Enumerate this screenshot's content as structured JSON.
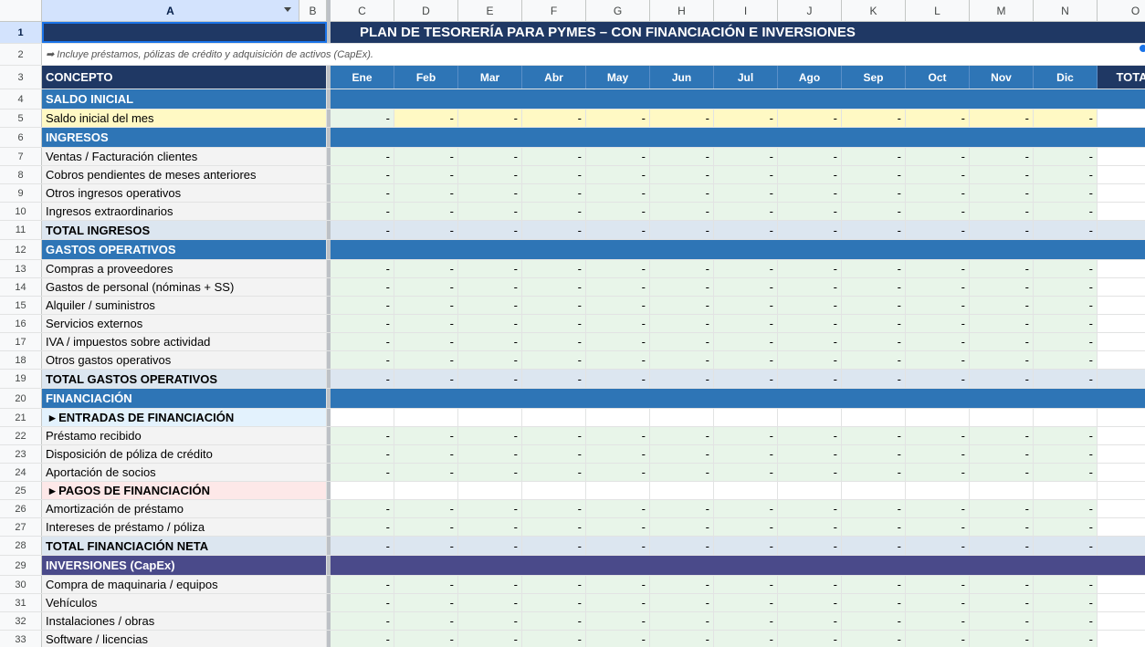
{
  "sheet": {
    "columns": [
      "A",
      "B",
      "C",
      "D",
      "E",
      "F",
      "G",
      "H",
      "I",
      "J",
      "K",
      "L",
      "M",
      "N",
      "O"
    ],
    "selected_column": "A",
    "title": "PLAN DE TESORERÍA PARA PYMES – CON FINANCIACIÓN E INVERSIONES",
    "note": "➡ Incluye préstamos, pólizas de crédito y adquisición de activos (CapEx).",
    "concept_header": "CONCEPTO",
    "months": [
      "Ene",
      "Feb",
      "Mar",
      "Abr",
      "May",
      "Jun",
      "Jul",
      "Ago",
      "Sep",
      "Oct",
      "Nov",
      "Dic"
    ],
    "total_header": "TOTAL",
    "empty_value": "-",
    "colors": {
      "title_bg": "#1f3864",
      "section_bg": "#2e75b6",
      "capex_bg": "#4a4a8a",
      "total_row_bg": "#dce6f0",
      "input_green": "#e8f5e9",
      "input_yellow": "#fff9c4",
      "entradas_bg": "#e3f2fd",
      "pagos_bg": "#fde8e8",
      "label_bg": "#f3f3f3"
    },
    "rows": [
      {
        "n": "4",
        "label": "SALDO INICIAL",
        "type": "section"
      },
      {
        "n": "5",
        "label": "Saldo inicial del mes",
        "type": "saldo"
      },
      {
        "n": "6",
        "label": "INGRESOS",
        "type": "section"
      },
      {
        "n": "7",
        "label": "Ventas / Facturación clientes",
        "type": "data"
      },
      {
        "n": "8",
        "label": "Cobros pendientes de meses anteriores",
        "type": "data"
      },
      {
        "n": "9",
        "label": "Otros ingresos operativos",
        "type": "data"
      },
      {
        "n": "10",
        "label": "Ingresos extraordinarios",
        "type": "data"
      },
      {
        "n": "11",
        "label": "TOTAL INGRESOS",
        "type": "total"
      },
      {
        "n": "12",
        "label": "GASTOS OPERATIVOS",
        "type": "section"
      },
      {
        "n": "13",
        "label": "Compras a proveedores",
        "type": "data"
      },
      {
        "n": "14",
        "label": "Gastos de personal (nóminas + SS)",
        "type": "data"
      },
      {
        "n": "15",
        "label": "Alquiler / suministros",
        "type": "data"
      },
      {
        "n": "16",
        "label": "Servicios externos",
        "type": "data"
      },
      {
        "n": "17",
        "label": "IVA / impuestos sobre actividad",
        "type": "data"
      },
      {
        "n": "18",
        "label": "Otros gastos operativos",
        "type": "data"
      },
      {
        "n": "19",
        "label": "TOTAL GASTOS OPERATIVOS",
        "type": "total"
      },
      {
        "n": "20",
        "label": "FINANCIACIÓN",
        "type": "section"
      },
      {
        "n": "21",
        "label": "▸ ENTRADAS DE FINANCIACIÓN",
        "type": "sub-in"
      },
      {
        "n": "22",
        "label": "Préstamo recibido",
        "type": "data"
      },
      {
        "n": "23",
        "label": "Disposición de póliza de crédito",
        "type": "data"
      },
      {
        "n": "24",
        "label": "Aportación de socios",
        "type": "data"
      },
      {
        "n": "25",
        "label": "▸ PAGOS DE FINANCIACIÓN",
        "type": "sub-out"
      },
      {
        "n": "26",
        "label": "Amortización de préstamo",
        "type": "data"
      },
      {
        "n": "27",
        "label": "Intereses de préstamo / póliza",
        "type": "data"
      },
      {
        "n": "28",
        "label": "TOTAL FINANCIACIÓN NETA",
        "type": "total"
      },
      {
        "n": "29",
        "label": "INVERSIONES (CapEx)",
        "type": "capex"
      },
      {
        "n": "30",
        "label": "Compra de maquinaria / equipos",
        "type": "data"
      },
      {
        "n": "31",
        "label": "Vehículos",
        "type": "data"
      },
      {
        "n": "32",
        "label": "Instalaciones / obras",
        "type": "data"
      },
      {
        "n": "33",
        "label": "Software / licencias",
        "type": "data"
      }
    ]
  }
}
